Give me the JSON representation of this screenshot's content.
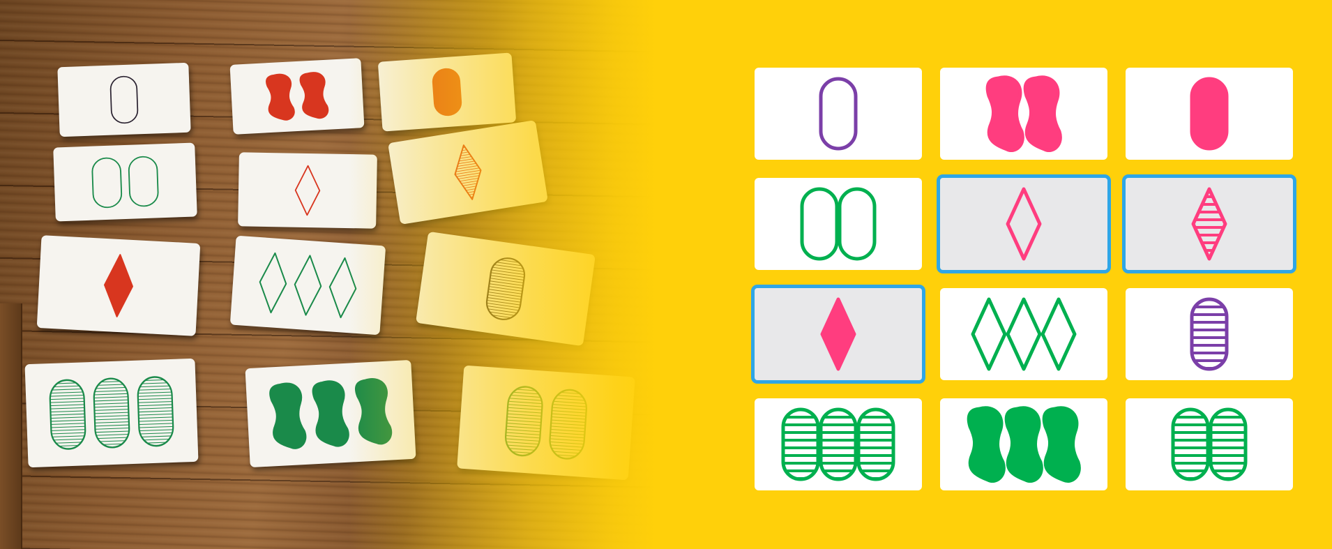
{
  "colors": {
    "background": "#FFD00A",
    "selection_border": "#2fa6e6",
    "card_selected_bg": "#e8e8ea",
    "purple": "#7b3fa8",
    "pink": "#ff3d7f",
    "green": "#00b04f",
    "photo_red": "#d8361f",
    "photo_orange": "#e0591f",
    "photo_green": "#1a8a4a",
    "photo_purple": "#2a2230"
  },
  "photo_cards": [
    {
      "id": "p1",
      "count": 1,
      "shape": "oval",
      "fill": "outline",
      "color": "photo_purple"
    },
    {
      "id": "p2",
      "count": 2,
      "shape": "squiggle",
      "fill": "solid",
      "color": "photo_red"
    },
    {
      "id": "p3",
      "count": 1,
      "shape": "oval",
      "fill": "solid",
      "color": "photo_orange"
    },
    {
      "id": "p4",
      "count": 2,
      "shape": "oval",
      "fill": "outline",
      "color": "photo_green"
    },
    {
      "id": "p5",
      "count": 1,
      "shape": "diamond",
      "fill": "outline",
      "color": "photo_red"
    },
    {
      "id": "p6",
      "count": 1,
      "shape": "diamond",
      "fill": "striped",
      "color": "photo_red"
    },
    {
      "id": "p7",
      "count": 1,
      "shape": "diamond",
      "fill": "solid",
      "color": "photo_red"
    },
    {
      "id": "p8",
      "count": 3,
      "shape": "diamond",
      "fill": "outline",
      "color": "photo_green"
    },
    {
      "id": "p9",
      "count": 1,
      "shape": "oval",
      "fill": "striped",
      "color": "photo_purple"
    },
    {
      "id": "p10",
      "count": 3,
      "shape": "oval",
      "fill": "striped",
      "color": "photo_green"
    },
    {
      "id": "p11",
      "count": 3,
      "shape": "squiggle",
      "fill": "solid",
      "color": "photo_green"
    },
    {
      "id": "p12",
      "count": 2,
      "shape": "oval",
      "fill": "striped",
      "color": "photo_green"
    }
  ],
  "digital_cards": [
    {
      "id": "d1",
      "count": 1,
      "shape": "oval",
      "fill": "outline",
      "color": "purple",
      "selected": false
    },
    {
      "id": "d2",
      "count": 2,
      "shape": "squiggle",
      "fill": "solid",
      "color": "pink",
      "selected": false
    },
    {
      "id": "d3",
      "count": 1,
      "shape": "oval",
      "fill": "solid",
      "color": "pink",
      "selected": false
    },
    {
      "id": "d4",
      "count": 2,
      "shape": "oval",
      "fill": "outline",
      "color": "green",
      "selected": false
    },
    {
      "id": "d5",
      "count": 1,
      "shape": "diamond",
      "fill": "outline",
      "color": "pink",
      "selected": true
    },
    {
      "id": "d6",
      "count": 1,
      "shape": "diamond",
      "fill": "striped",
      "color": "pink",
      "selected": true
    },
    {
      "id": "d7",
      "count": 1,
      "shape": "diamond",
      "fill": "solid",
      "color": "pink",
      "selected": true
    },
    {
      "id": "d8",
      "count": 3,
      "shape": "diamond",
      "fill": "outline",
      "color": "green",
      "selected": false
    },
    {
      "id": "d9",
      "count": 1,
      "shape": "oval",
      "fill": "striped",
      "color": "purple",
      "selected": false
    },
    {
      "id": "d10",
      "count": 3,
      "shape": "oval",
      "fill": "striped",
      "color": "green",
      "selected": false
    },
    {
      "id": "d11",
      "count": 3,
      "shape": "squiggle",
      "fill": "solid",
      "color": "green",
      "selected": false
    },
    {
      "id": "d12",
      "count": 2,
      "shape": "oval",
      "fill": "striped",
      "color": "green",
      "selected": false
    }
  ]
}
